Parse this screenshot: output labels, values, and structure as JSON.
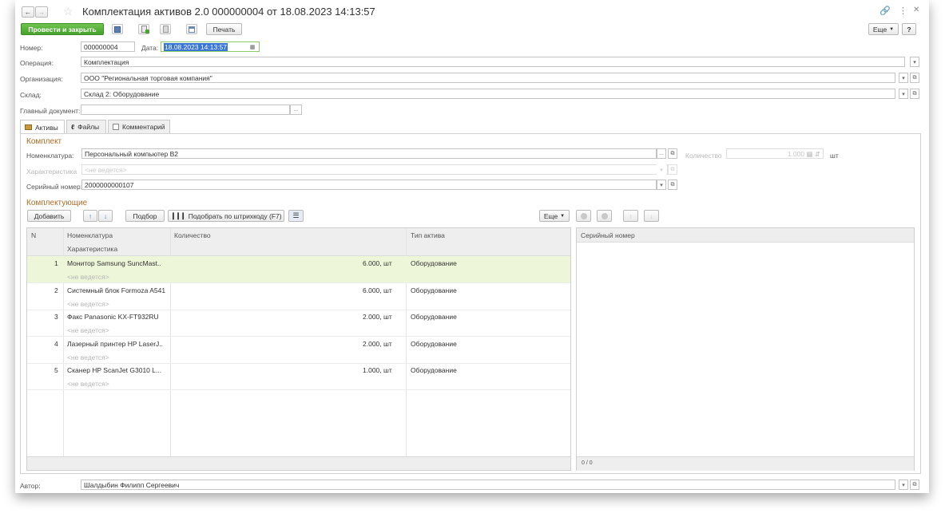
{
  "window": {
    "title": "Комплектация активов 2.0 000000004 от 18.08.2023 14:13:57"
  },
  "toolbar": {
    "post_close_label": "Провести и закрыть",
    "print_label": "Печать",
    "more_label": "Еще",
    "help_label": "?"
  },
  "header": {
    "number_label": "Номер:",
    "number_value": "000000004",
    "date_label": "Дата:",
    "date_value": "18.08.2023 14:13:57",
    "operation_label": "Операция:",
    "operation_value": "Комплектация",
    "organization_label": "Организация:",
    "organization_value": "ООО \"Региональная торговая компания\"",
    "warehouse_label": "Склад:",
    "warehouse_value": "Склад 2: Оборудование",
    "main_doc_label": "Главный документ:",
    "main_doc_value": ""
  },
  "tabs": [
    {
      "label": "Активы"
    },
    {
      "label": "Файлы"
    },
    {
      "label": "Комментарий"
    }
  ],
  "kit": {
    "section_title": "Комплект",
    "nomenclature_label": "Номенклатура:",
    "nomenclature_value": "Персональный компьютер B2",
    "quantity_label": "Количество",
    "quantity_value": "1.000",
    "unit": "шт",
    "characteristic_label": "Характеристика",
    "characteristic_value": "<не ведется>",
    "serial_label": "Серийный номер:",
    "serial_value": "2000000000107"
  },
  "components": {
    "section_title": "Комплектующие",
    "add_label": "Добавить",
    "pick_label": "Подбор",
    "barcode_label": "Подобрать по штрихкоду (F7)",
    "more_label": "Еще",
    "columns": {
      "n": "N",
      "nomenclature": "Номенклатура",
      "characteristic": "Характеристика",
      "quantity": "Количество",
      "asset_type": "Тип актива"
    },
    "rows": [
      {
        "n": "1",
        "name": "Монитор Samsung SuncMast..",
        "char": "<не ведется>",
        "qty": "6.000, шт",
        "type": "Оборудование"
      },
      {
        "n": "2",
        "name": "Системный блок Formoza A541",
        "char": "<не ведется>",
        "qty": "6.000, шт",
        "type": "Оборудование"
      },
      {
        "n": "3",
        "name": "Факс Panasonic KX-FT932RU",
        "char": "<не ведется>",
        "qty": "2.000, шт",
        "type": "Оборудование"
      },
      {
        "n": "4",
        "name": "Лазерный принтер HP LaserJ..",
        "char": "<не ведется>",
        "qty": "2.000, шт",
        "type": "Оборудование"
      },
      {
        "n": "5",
        "name": "Сканер HP ScanJet G3010 L...",
        "char": "<не ведется>",
        "qty": "1.000, шт",
        "type": "Оборудование"
      }
    ]
  },
  "serials": {
    "column": "Серийный номер",
    "counter": "0 / 0"
  },
  "footer": {
    "author_label": "Автор:",
    "author_value": "Шалдыбин Филипп Сергеевич"
  },
  "colors": {
    "accent_green": "#4aa52e",
    "section_title": "#b06b25",
    "selected_row": "#edf6d8"
  }
}
